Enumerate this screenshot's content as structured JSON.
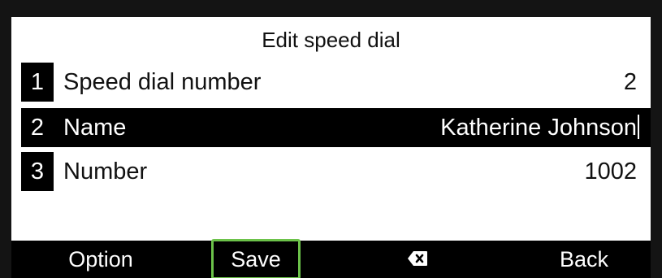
{
  "screen": {
    "title": "Edit speed dial"
  },
  "fields": [
    {
      "index": "1",
      "label": "Speed dial number",
      "value": "2",
      "selected": false
    },
    {
      "index": "2",
      "label": "Name",
      "value": "Katherine Johnson",
      "selected": true
    },
    {
      "index": "3",
      "label": "Number",
      "value": "1002",
      "selected": false
    }
  ],
  "softkeys": {
    "option": "Option",
    "save": "Save",
    "backspace_icon": "backspace-icon",
    "back": "Back"
  },
  "colors": {
    "highlight_border": "#6cc24a",
    "selected_row_bg": "#000000"
  }
}
